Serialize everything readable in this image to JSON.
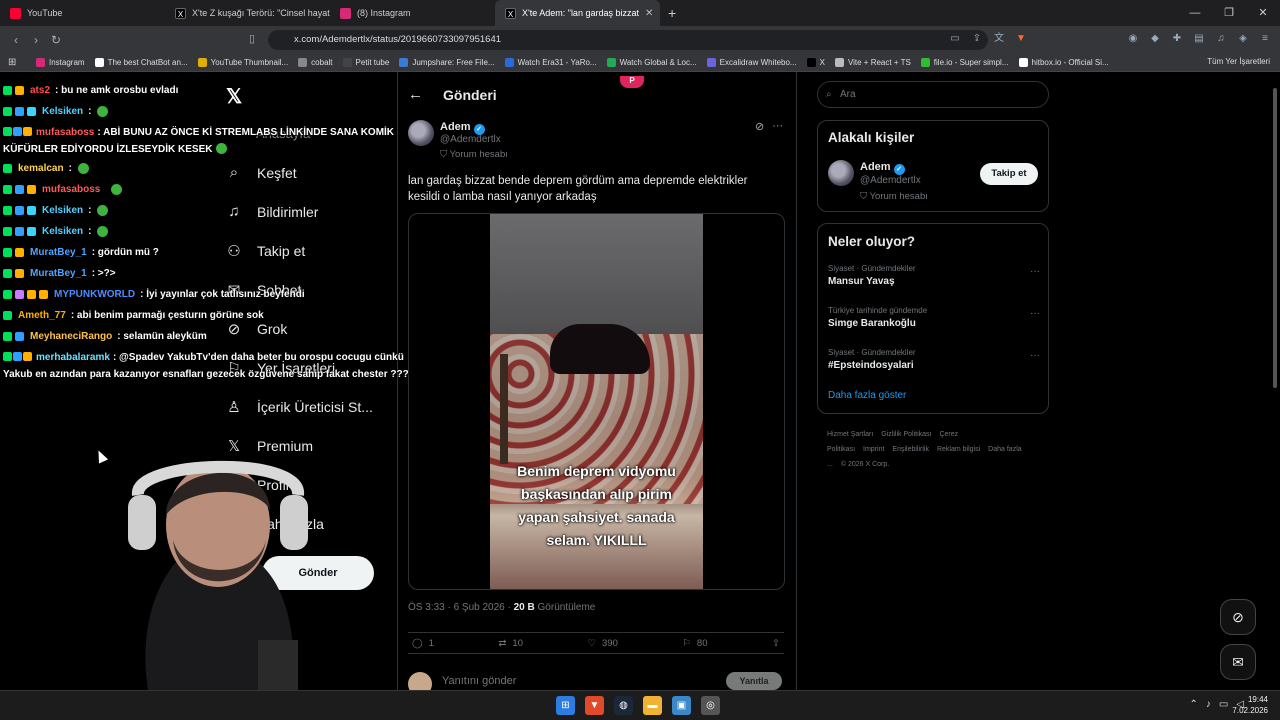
{
  "browser": {
    "tabs": [
      {
        "title": "YouTube",
        "icon": "youtube-icon",
        "color": "#ff0033",
        "active": false
      },
      {
        "title": "X'te Z kuşağı Terörü: \"Cinsel hayatı c...",
        "icon": "x-logo-icon",
        "color": "#000000",
        "active": false
      },
      {
        "title": "(8) Instagram",
        "icon": "instagram-icon",
        "color": "#d62976",
        "active": false
      },
      {
        "title": "X'te Adem: \"lan gardaş bizzat",
        "icon": "x-logo-icon",
        "color": "#000000",
        "active": true
      }
    ],
    "url": "x.com/Ademdertlx/status/2019660733097951641",
    "bookmarks": [
      {
        "label": "Instagram",
        "color": "#d62976"
      },
      {
        "label": "The best ChatBot an...",
        "color": "#ffffff"
      },
      {
        "label": "YouTube Thumbnail...",
        "color": "#e0b000"
      },
      {
        "label": "cobalt",
        "color": "#888888"
      },
      {
        "label": "Petit tube",
        "color": "#444444"
      },
      {
        "label": "Jumpshare: Free File...",
        "color": "#3a7bd5"
      },
      {
        "label": "Watch Era31 - YaRo...",
        "color": "#2a6bd5"
      },
      {
        "label": "Watch Global & Loc...",
        "color": "#22aa55"
      },
      {
        "label": "Excalidraw Whitebo...",
        "color": "#6965db"
      },
      {
        "label": "X",
        "color": "#000000"
      },
      {
        "label": "Vite + React + TS",
        "color": "#bbbbbb"
      },
      {
        "label": "file.io - Super simpl...",
        "color": "#33bb33"
      },
      {
        "label": "hitbox.io - Official Si...",
        "color": "#ffffff"
      }
    ],
    "all_bookmarks": "Tüm Yer İşaretleri"
  },
  "nav": {
    "items": [
      {
        "label": "Keşfet",
        "icon": "search-icon"
      },
      {
        "label": "Bildirimler",
        "icon": "bell-icon"
      },
      {
        "label": "Takip et",
        "icon": "person-add-icon"
      },
      {
        "label": "Sohbet",
        "icon": "chat-icon"
      },
      {
        "label": "Grok",
        "icon": "grok-icon"
      },
      {
        "label": "Yer İşaretleri",
        "icon": "bookmark-icon"
      },
      {
        "label": "İçerik Üreticisi St...",
        "icon": "creator-studio-icon"
      },
      {
        "label": "Premium",
        "icon": "x-premium-icon"
      },
      {
        "label": "Profil",
        "icon": "profile-icon"
      },
      {
        "label": "Daha fazla",
        "icon": "more-icon"
      }
    ],
    "home_partial": "Anasayfa",
    "post_button": "Gönder"
  },
  "post": {
    "header_title": "Gönderi",
    "author_name": "Adem",
    "author_handle": "@Ademdertlx",
    "author_tag": "Yorum hesabı",
    "text": "lan gardaş bizzat bende deprem gördüm ama depremde elektrikler kesildi o lamba nasıl yanıyor arkadaş",
    "video_caption": "Benim deprem vidyomu başkasından alıp pirim yapan şahsiyet. sanada selam. YIKILLL",
    "time": "ÖS 3:33 · 6 Şub 2026 ·",
    "views": "20 B",
    "views_label": "Görüntüleme",
    "replies": "1",
    "reposts": "10",
    "likes": "390",
    "bookmarks": "80",
    "reply_placeholder": "Yanıtını gönder",
    "reply_button": "Yanıtla"
  },
  "sidebar": {
    "search_placeholder": "Ara",
    "people_title": "Alakalı kişiler",
    "person_name": "Adem",
    "person_handle": "@Ademdertlx",
    "person_tag": "Yorum hesabı",
    "follow_label": "Takip et",
    "trends_title": "Neler oluyor?",
    "trends": [
      {
        "category": "Siyaset · Gündemdekiler",
        "name": "Mansur Yavaş"
      },
      {
        "category": "Türkiye tarihinde gündemde",
        "name": "Simge Barankoğlu"
      },
      {
        "category": "Siyaset · Gündemdekiler",
        "name": "#Epsteindosyalari"
      }
    ],
    "show_more": "Daha fazla göster",
    "footer": [
      "Hizmet Şartları",
      "Gizlilik Politikası",
      "Çerez Politikası",
      "Imprint",
      "Erişilebilirlik",
      "Reklam bilgisi",
      "Daha fazla ...",
      "© 2026 X Corp."
    ]
  },
  "chat": [
    {
      "user": "ats2",
      "color": "#ff4d4d",
      "badges": [
        "#00e05a",
        "#ffb000"
      ],
      "text": ": bu ne amk orosbu evladı",
      "emote": false
    },
    {
      "user": "Kelsiken",
      "color": "#4fd1ff",
      "badges": [
        "#00e05a",
        "#2fa0ff",
        "#3ad4ff"
      ],
      "text": ":",
      "emote": true
    },
    {
      "user": "mufasaboss",
      "color": "#ff5a5a",
      "badges": [
        "#00e05a",
        "#2fa0ff",
        "#ffb000"
      ],
      "text": ": ABİ BUNU AZ ÖNCE Kİ STREMLABS LİNKİNDE SANA KOMİK KÜFÜRLER EDİYORDU İZLESEYDİK KESEK",
      "emote": true,
      "wrap": true
    },
    {
      "user": "kemalcan",
      "color": "#ffd24d",
      "badges": [
        "#00e05a"
      ],
      "text": ":",
      "emote": true
    },
    {
      "user": "mufasaboss",
      "color": "#ff5a5a",
      "badges": [
        "#00e05a",
        "#2fa0ff",
        "#ffb000"
      ],
      "text": "",
      "emote": true
    },
    {
      "user": "Kelsiken",
      "color": "#4fd1ff",
      "badges": [
        "#00e05a",
        "#2fa0ff",
        "#3ad4ff"
      ],
      "text": ":",
      "emote": true
    },
    {
      "user": "Kelsiken",
      "color": "#4fd1ff",
      "badges": [
        "#00e05a",
        "#2fa0ff",
        "#3ad4ff"
      ],
      "text": ":",
      "emote": true
    },
    {
      "user": "MuratBey_1",
      "color": "#4da3ff",
      "badges": [
        "#00e05a",
        "#ffb000"
      ],
      "text": ": gördün mü ?",
      "emote": false
    },
    {
      "user": "MuratBey_1",
      "color": "#4da3ff",
      "badges": [
        "#00e05a",
        "#ffb000"
      ],
      "text": ": >?>",
      "emote": false
    },
    {
      "user": "MYPUNKWORLD",
      "color": "#4d8dff",
      "badges": [
        "#00e05a",
        "#c77dff",
        "#ffb000",
        "#ffb000"
      ],
      "text": ": İyi yayınlar çok tatlısınız beyfendi",
      "emote": false
    },
    {
      "user": "Ameth_77",
      "color": "#ffb000",
      "badges": [
        "#00e05a"
      ],
      "text": ": abi benim parmağı çesturın görüne sok",
      "emote": false
    },
    {
      "user": "MeyhaneciRango",
      "color": "#ffc04d",
      "badges": [
        "#00e05a",
        "#2fa0ff"
      ],
      "text": ": selamün aleyküm",
      "emote": false
    },
    {
      "user": "merhabalaramk",
      "color": "#6be0ff",
      "badges": [
        "#00e05a",
        "#2fa0ff",
        "#ffb000"
      ],
      "text": ": @Spadev YakubTv'den daha beter bu orospu cocugu cünkü Yakub en azından para kazanıyor esnafları gezecek özgüvene sahip fakat chester ???",
      "emote": false,
      "wrap": true
    }
  ],
  "taskbar": {
    "time": "19:44",
    "date": "7.02.2026"
  }
}
